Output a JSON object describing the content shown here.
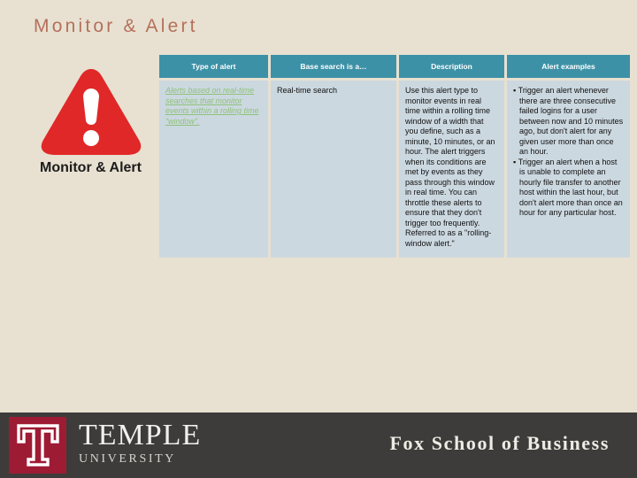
{
  "slide": {
    "title": "Monitor & Alert",
    "title_color": "#b5705c",
    "background_color": "#e8e1d1"
  },
  "illustration": {
    "icon": "warning-triangle-icon",
    "icon_color": "#e02828",
    "caption": "Monitor & Alert"
  },
  "table": {
    "header_color": "#3d91a6",
    "cell_color": "#ccd8e0",
    "link_color": "#8fc27a",
    "columns": [
      "Type of alert",
      "Base search is a…",
      "Description",
      "Alert examples"
    ],
    "rows": [
      {
        "type_of_alert": "Alerts based on real-time searches that monitor events within a rolling time “window”.",
        "base_search": "Real-time search",
        "description": "Use this alert type to monitor events in real time within a rolling time window of a width that you define, such as a minute, 10 minutes, or an hour. The alert triggers when its conditions are met by events as they pass through this window in real time. You can throttle these alerts to ensure that they don't trigger too frequently. Referred to as a \"rolling-window alert.\"",
        "alert_examples": [
          "Trigger an alert whenever there are three consecutive failed logins for a user between now and 10 minutes ago, but don't alert for any given user more than once an hour.",
          "Trigger an alert when a host is unable to complete an hourly file transfer to another host within the last hour, but don't alert more than once an hour for any particular host."
        ]
      }
    ]
  },
  "footer": {
    "background_color": "#3d3c3a",
    "logo_mark_color": "#9e1b34",
    "university_name": "TEMPLE",
    "university_sub": "UNIVERSITY",
    "school_name": "Fox School of Business"
  }
}
